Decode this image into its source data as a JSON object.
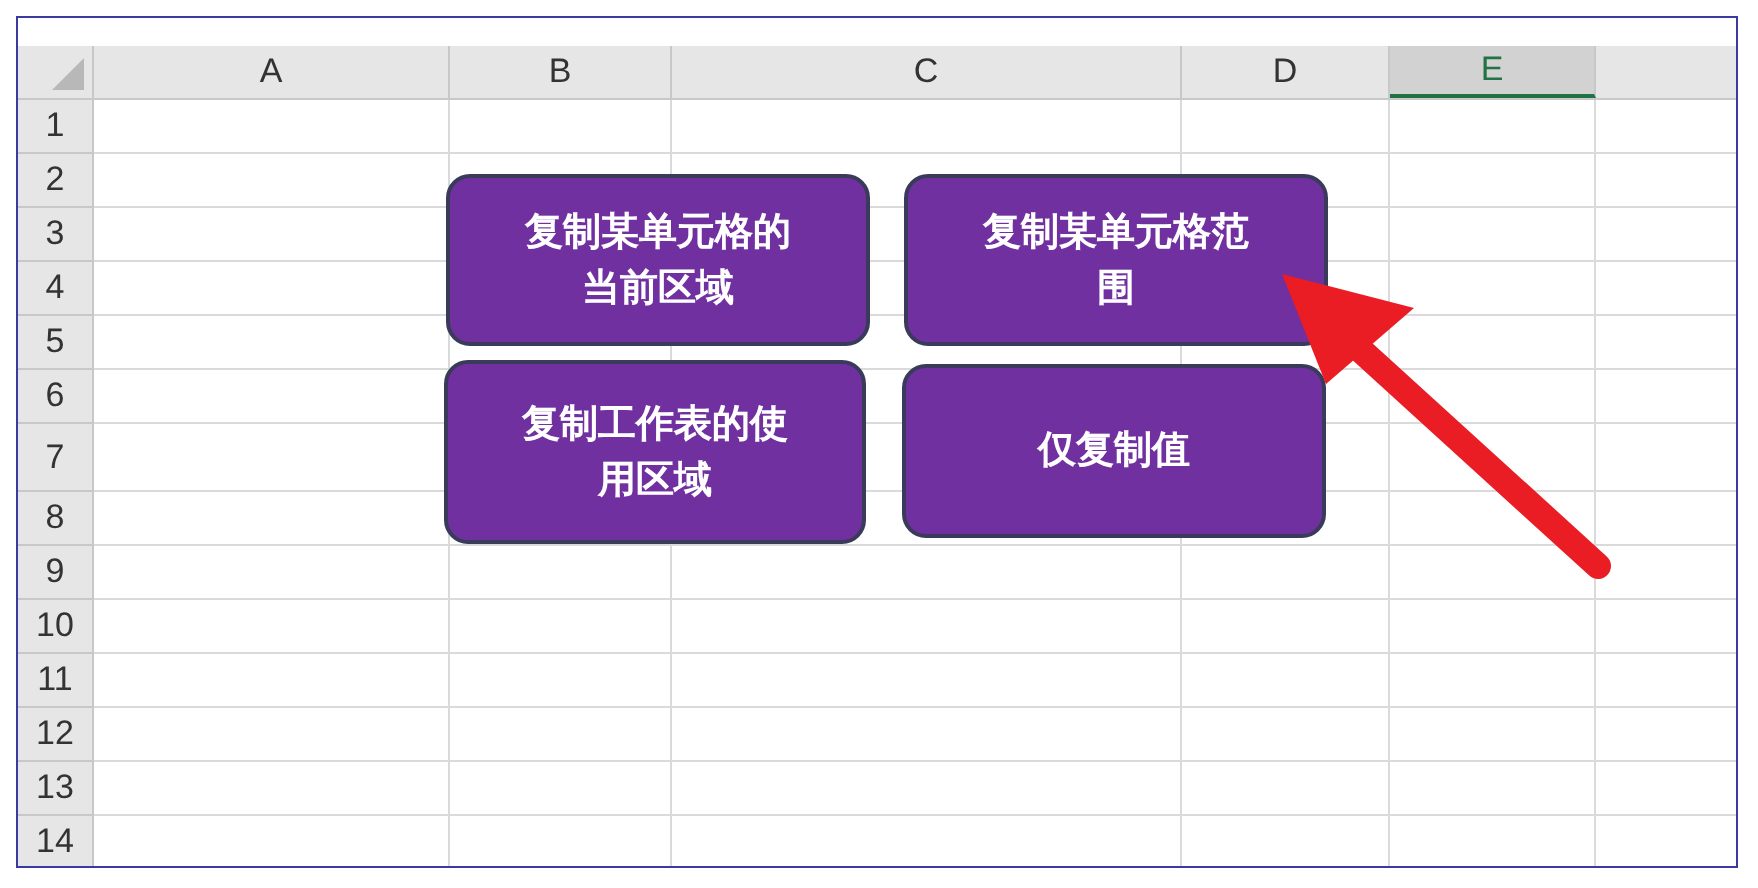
{
  "columns": [
    {
      "label": "A",
      "selected": false
    },
    {
      "label": "B",
      "selected": false
    },
    {
      "label": "C",
      "selected": false
    },
    {
      "label": "D",
      "selected": false
    },
    {
      "label": "E",
      "selected": true
    }
  ],
  "rows": [
    "1",
    "2",
    "3",
    "4",
    "5",
    "6",
    "7",
    "8",
    "9",
    "10",
    "11",
    "12",
    "13",
    "14"
  ],
  "buttons": [
    {
      "text": "复制某单元格的当前区域"
    },
    {
      "text": "复制某单元格范围"
    },
    {
      "text": "复制工作表的使用区域"
    },
    {
      "text": "仅复制值"
    }
  ]
}
